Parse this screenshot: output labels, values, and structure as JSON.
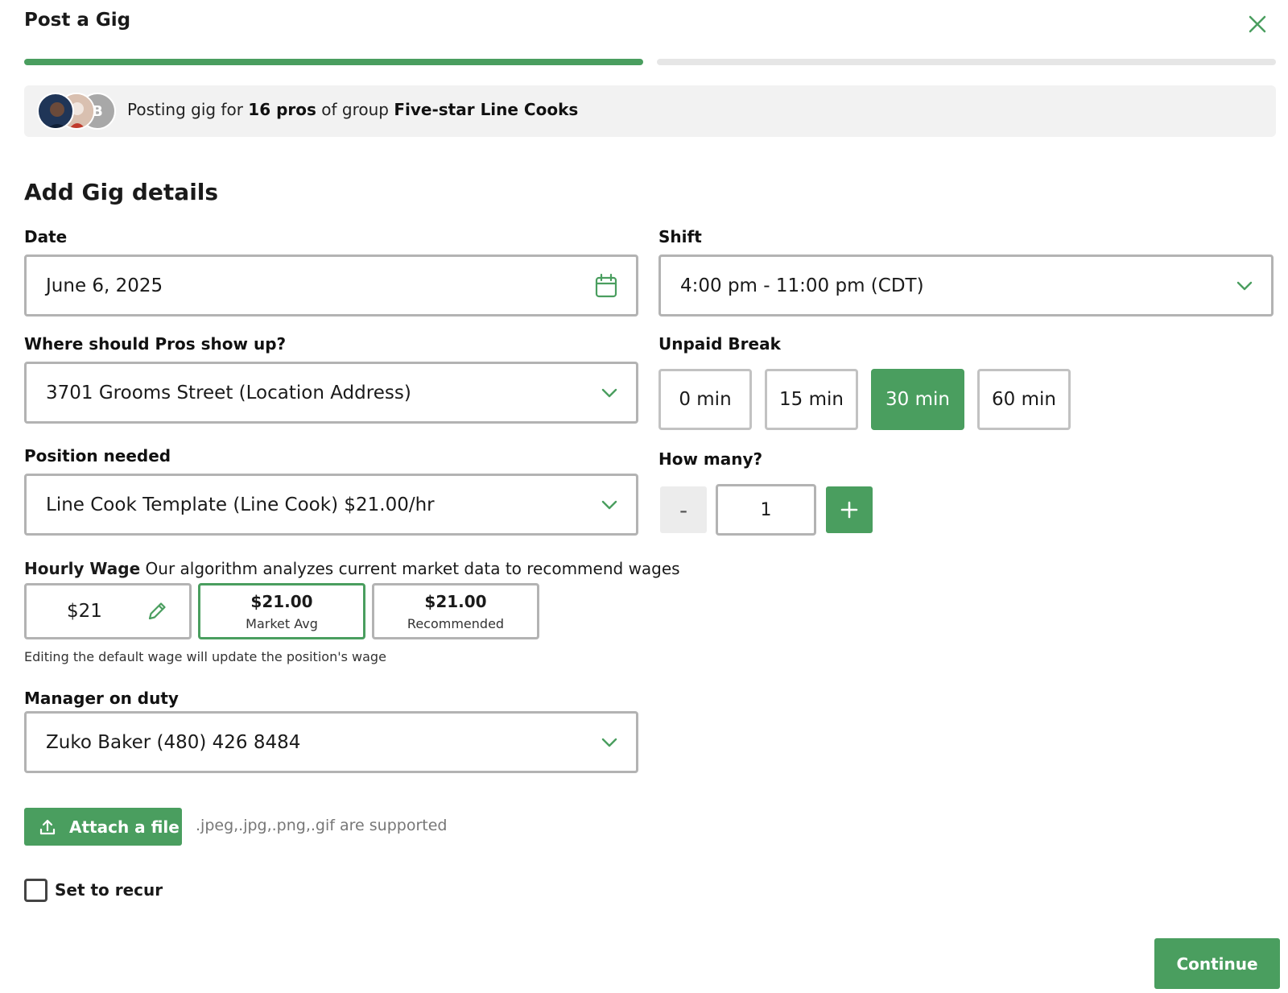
{
  "header": {
    "title": "Post a Gig",
    "close_icon": "close-icon"
  },
  "progress": {
    "steps_total": 2,
    "steps_completed": 1
  },
  "banner": {
    "prefix": "Posting gig for ",
    "pros_count": "16 pros",
    "middle": " of group ",
    "group_name": "Five-star Line Cooks",
    "avatar_letter": "B"
  },
  "section_title": "Add Gig details",
  "date": {
    "label": "Date",
    "value": "June 6, 2025",
    "icon": "calendar-icon"
  },
  "shift": {
    "label": "Shift",
    "value": "4:00 pm - 11:00 pm (CDT)"
  },
  "location": {
    "label": "Where should Pros show up?",
    "value": "3701 Grooms Street (Location Address)"
  },
  "unpaid_break": {
    "label": "Unpaid Break",
    "options": [
      "0 min",
      "15 min",
      "30 min",
      "60 min"
    ],
    "selected": "30 min"
  },
  "position": {
    "label": "Position needed",
    "value": "Line Cook Template (Line Cook) $21.00/hr"
  },
  "how_many": {
    "label": "How many?",
    "minus": "-",
    "value": "1",
    "plus": "+"
  },
  "hourly_wage": {
    "label": "Hourly Wage",
    "description": "Our algorithm analyzes current market data to recommend wages",
    "current": "$21",
    "market_avg": {
      "amount": "$21.00",
      "caption": "Market Avg"
    },
    "recommended": {
      "amount": "$21.00",
      "caption": "Recommended"
    },
    "note": "Editing the default wage will update the position's wage"
  },
  "manager": {
    "label": "Manager on duty",
    "value": "Zuko Baker (480) 426 8484"
  },
  "attach": {
    "button_label": "Attach a file",
    "note": ".jpeg,.jpg,.png,.gif are supported"
  },
  "recur": {
    "label": "Set to recur",
    "checked": false
  },
  "continue_label": "Continue",
  "colors": {
    "accent": "#4a9e5f",
    "border": "#b3b3b3",
    "banner_bg": "#f2f2f2"
  }
}
